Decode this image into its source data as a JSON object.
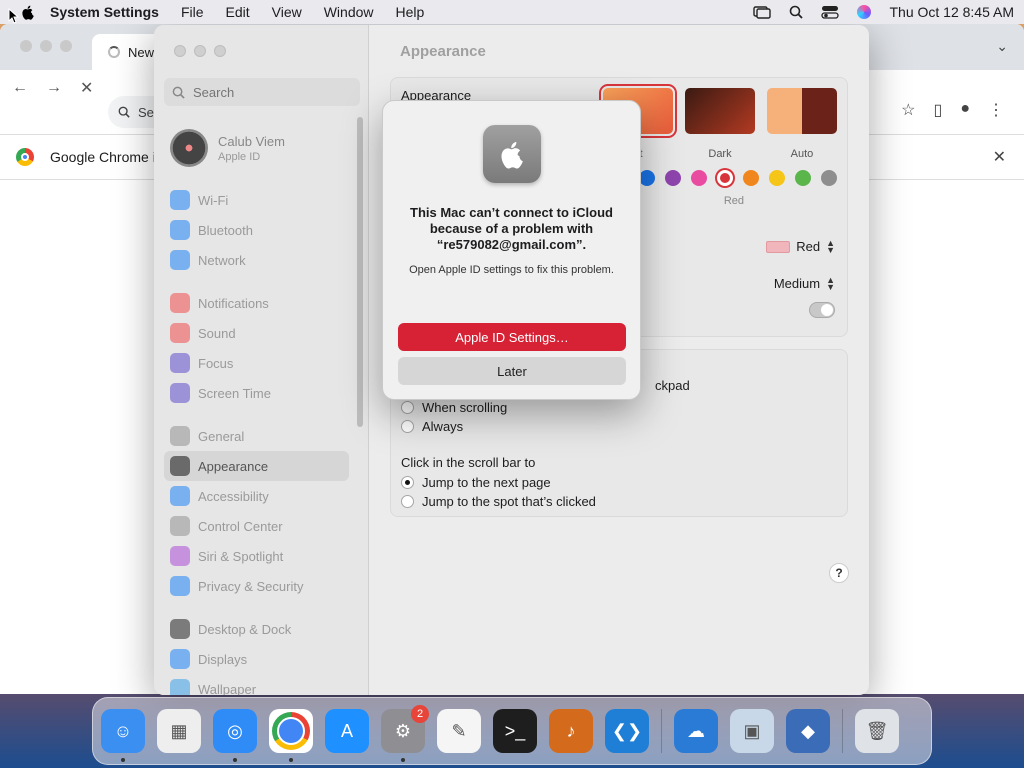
{
  "menubar": {
    "app_name": "System Settings",
    "menus": [
      "File",
      "Edit",
      "View",
      "Window",
      "Help"
    ],
    "datetime": "Thu Oct 12  8:45 AM"
  },
  "chrome": {
    "tab_title": "New",
    "omnibox_text": "Se",
    "infobar_text": "Google Chrome i"
  },
  "settings": {
    "title": "Appearance",
    "search_placeholder": "Search",
    "account": {
      "name": "Calub Viem",
      "subtitle": "Apple ID"
    },
    "sidebar_items": [
      {
        "label": "Wi-Fi",
        "icon": "wifi-icon",
        "color": "#2f8cf7"
      },
      {
        "label": "Bluetooth",
        "icon": "bluetooth-icon",
        "color": "#2f8cf7"
      },
      {
        "label": "Network",
        "icon": "globe-icon",
        "color": "#2f8cf7"
      },
      {
        "label": "Notifications",
        "icon": "bell-icon",
        "color": "#f15a5a"
      },
      {
        "label": "Sound",
        "icon": "speaker-icon",
        "color": "#f15a5a"
      },
      {
        "label": "Focus",
        "icon": "moon-icon",
        "color": "#6a5acd"
      },
      {
        "label": "Screen Time",
        "icon": "hourglass-icon",
        "color": "#6a5acd"
      },
      {
        "label": "General",
        "icon": "gear-icon",
        "color": "#9a9a9a"
      },
      {
        "label": "Appearance",
        "icon": "appearance-icon",
        "color": "#222222"
      },
      {
        "label": "Accessibility",
        "icon": "accessibility-icon",
        "color": "#2f8cf7"
      },
      {
        "label": "Control Center",
        "icon": "control-center-icon",
        "color": "#9a9a9a"
      },
      {
        "label": "Siri & Spotlight",
        "icon": "siri-icon",
        "color": "#b05ad8"
      },
      {
        "label": "Privacy & Security",
        "icon": "hand-icon",
        "color": "#2f8cf7"
      },
      {
        "label": "Desktop & Dock",
        "icon": "dock-icon",
        "color": "#333333"
      },
      {
        "label": "Displays",
        "icon": "sun-icon",
        "color": "#2f8cf7"
      },
      {
        "label": "Wallpaper",
        "icon": "wallpaper-icon",
        "color": "#49a7e8"
      }
    ],
    "appearance_label": "Appearance",
    "appearance_options": [
      "Light",
      "Dark",
      "Auto"
    ],
    "appearance_visible_light": "ht",
    "accent_label": "Red",
    "accent_colors": [
      "#1a73e8",
      "#8e44ad",
      "#e94ba0",
      "#d8353b",
      "#f0861e",
      "#f5c518",
      "#5ab54b",
      "#8e8e8e"
    ],
    "highlight_value": "Red",
    "sidebar_icon_size_value": "Medium",
    "scroll_partial": "ckpad",
    "scroll_options": [
      "When scrolling",
      "Always"
    ],
    "click_label": "Click in the scroll bar to",
    "click_options": [
      "Jump to the next page",
      "Jump to the spot that’s clicked"
    ],
    "help": "?"
  },
  "alert": {
    "title": "This Mac can’t connect to iCloud because of a problem with “re579082@gmail.com”.",
    "message": "Open Apple ID settings to fix this problem.",
    "primary_button": "Apple ID Settings…",
    "secondary_button": "Later"
  },
  "dock": {
    "apps": [
      {
        "name": "finder-icon",
        "color": "#3b8ff0"
      },
      {
        "name": "launchpad-icon",
        "color": "#eeeeee"
      },
      {
        "name": "safari-icon",
        "color": "#2f8cf7"
      },
      {
        "name": "chrome-icon",
        "color": "#ffffff"
      },
      {
        "name": "app-store-icon",
        "color": "#1e90ff"
      },
      {
        "name": "system-settings-icon",
        "color": "#8e8e93"
      },
      {
        "name": "textedit-icon",
        "color": "#f5f5f5"
      },
      {
        "name": "terminal-icon",
        "color": "#1e1e1e"
      },
      {
        "name": "garageband-icon",
        "color": "#d46a1b"
      },
      {
        "name": "vscode-icon",
        "color": "#1f7fd6"
      },
      {
        "name": "weather-icon",
        "color": "#2a7bd6"
      },
      {
        "name": "preview-icon",
        "color": "#c8d8e8"
      },
      {
        "name": "virtualbox-icon",
        "color": "#3b6cb7"
      },
      {
        "name": "trash-icon",
        "color": "#dfe3e8"
      }
    ],
    "settings_badge": "2"
  }
}
